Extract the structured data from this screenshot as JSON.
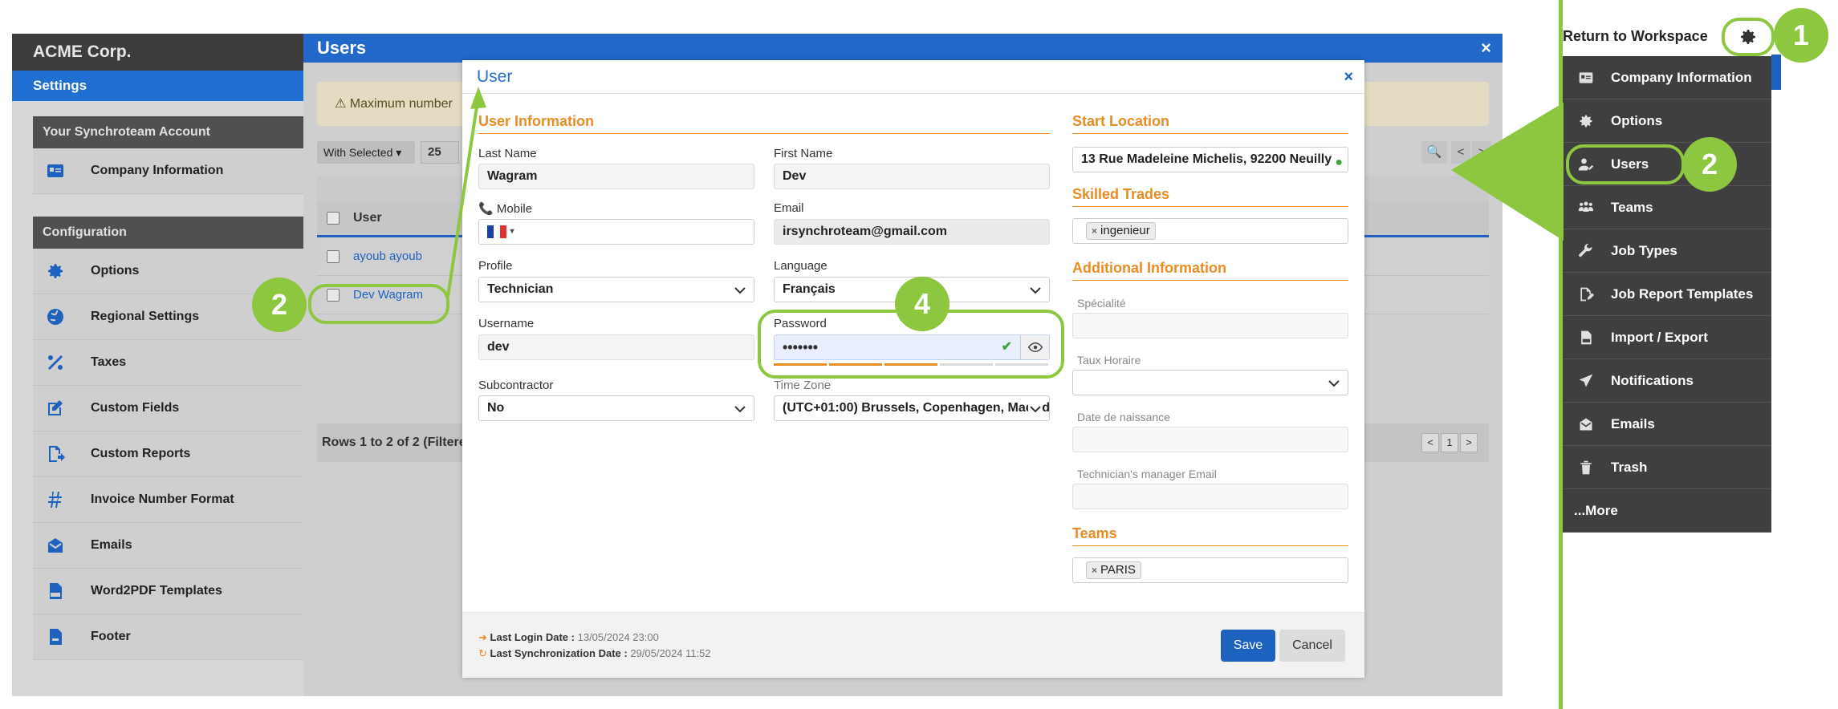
{
  "left_panel": {
    "brand": "ACME Corp.",
    "settings": "Settings",
    "account_header": "Your Synchroteam Account",
    "account_items": [
      {
        "label": "Company Information",
        "icon": "id-card-icon"
      }
    ],
    "config_header": "Configuration",
    "config_items": [
      {
        "label": "Options",
        "icon": "gear-icon"
      },
      {
        "label": "Regional Settings",
        "icon": "globe-icon"
      },
      {
        "label": "Taxes",
        "icon": "percent-icon"
      },
      {
        "label": "Custom Fields",
        "icon": "edit-icon"
      },
      {
        "label": "Custom Reports",
        "icon": "report-icon"
      },
      {
        "label": "Invoice Number Format",
        "icon": "hash-icon"
      },
      {
        "label": "Emails",
        "icon": "envelope-icon"
      },
      {
        "label": "Word2PDF Templates",
        "icon": "pdf-icon"
      },
      {
        "label": "Footer",
        "icon": "footer-icon"
      }
    ]
  },
  "users_page": {
    "title": "Users",
    "close": "×",
    "warning": "⚠ Maximum number",
    "with_selected": "With Selected ▾",
    "page_size": "25",
    "column_user": "User",
    "rows": [
      "ayoub ayoub",
      "Dev Wagram"
    ],
    "rows_summary": "Rows 1 to 2 of 2 (Filtere",
    "pager": [
      "<",
      "1",
      ">"
    ],
    "nav_prev": "<",
    "nav_next": ">",
    "search_icon": "🔍"
  },
  "modal": {
    "title": "User",
    "close": "×",
    "user_info_title": "User Information",
    "last_name_label": "Last Name",
    "last_name": "Wagram",
    "first_name_label": "First Name",
    "first_name": "Dev",
    "mobile_label": "Mobile",
    "email_label": "Email",
    "email": "irsynchroteam@gmail.com",
    "profile_label": "Profile",
    "profile": "Technician",
    "language_label": "Language",
    "language": "Français",
    "username_label": "Username",
    "username": "dev",
    "password_label": "Password",
    "password": "•••••••",
    "subcontractor_label": "Subcontractor",
    "subcontractor": "No",
    "timezone_label": "Time Zone",
    "timezone": "(UTC+01:00) Brussels, Copenhagen, Madrid",
    "start_location_title": "Start Location",
    "start_location": "13 Rue Madeleine Michelis, 92200 Neuilly",
    "skilled_trades_title": "Skilled Trades",
    "skilled_trade_tag": "ingenieur",
    "additional_info_title": "Additional Information",
    "specialite_label": "Spécialité",
    "taux_label": "Taux Horaire",
    "date_label": "Date de naissance",
    "manager_email_label": "Technician's manager Email",
    "teams_title": "Teams",
    "team_tag": "PARIS",
    "last_login_label": "Last Login Date :",
    "last_login_value": "13/05/2024 23:00",
    "last_sync_label": "Last Synchronization Date :",
    "last_sync_value": "29/05/2024 11:52",
    "save": "Save",
    "cancel": "Cancel"
  },
  "right_menu": {
    "return_label": "Return to Workspace",
    "items": [
      {
        "label": "Company Information",
        "icon": "id-card-icon"
      },
      {
        "label": "Options",
        "icon": "gear-icon"
      },
      {
        "label": "Users",
        "icon": "user-icon"
      },
      {
        "label": "Teams",
        "icon": "team-icon"
      },
      {
        "label": "Job Types",
        "icon": "wrench-icon"
      },
      {
        "label": "Job Report Templates",
        "icon": "report-template-icon"
      },
      {
        "label": "Import / Export",
        "icon": "csv-icon"
      },
      {
        "label": "Notifications",
        "icon": "paper-plane-icon"
      },
      {
        "label": "Emails",
        "icon": "envelope-icon"
      },
      {
        "label": "Trash",
        "icon": "trash-icon"
      }
    ],
    "more": "...More"
  },
  "callouts": {
    "one": "1",
    "two": "2",
    "four": "4"
  },
  "colors": {
    "accent_green": "#8dc63f",
    "brand_blue": "#1e62c0",
    "section_orange": "#e88d23"
  }
}
